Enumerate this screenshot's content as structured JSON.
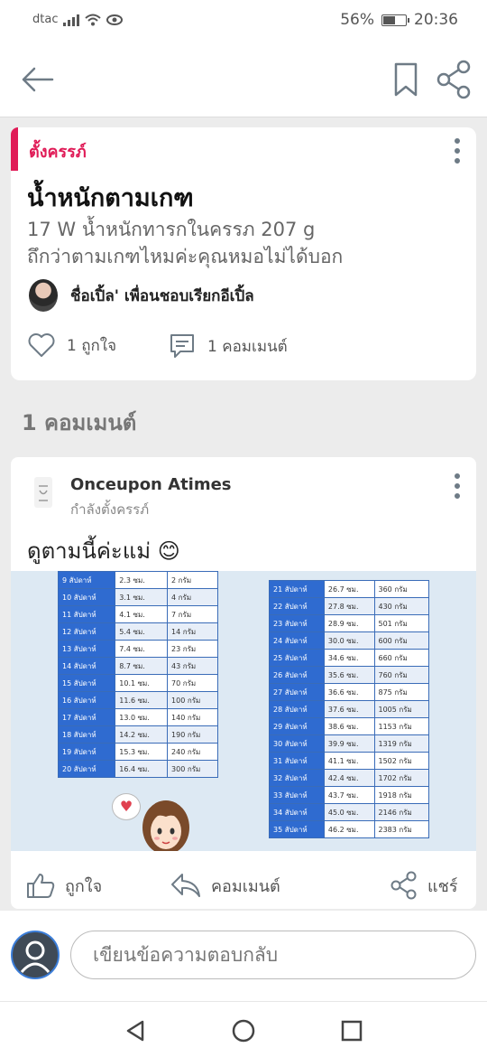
{
  "status_bar": {
    "carrier": "dtac",
    "battery_text": "56%",
    "battery_level": 0.56,
    "time": "20:36"
  },
  "post": {
    "tag": "ตั้งครรภ์",
    "title": "น้ำหนักตามเกฑ",
    "body": "17 W น้ำหนักทารกในครรภ 207 g\nถึกว่าตามเกฑไหมค่ะคุณหมอไม่ได้บอก",
    "author": "ชื่อเปิ้ล' เพื่อนชอบเรียกอีเปิ้ล",
    "likes_label": "1 ถูกใจ",
    "comments_label": "1 คอมเมนต์"
  },
  "comments_heading": "1 คอมเมนต์",
  "comment": {
    "author": "Onceupon Atimes",
    "status": "กำลังตั้งครรภ์",
    "text": "ดูตามนี้ค่ะแม่ 😊",
    "image": {
      "left_table": [
        [
          "9 สัปดาห์",
          "2.3 ซม.",
          "2 กรัม"
        ],
        [
          "10 สัปดาห์",
          "3.1 ซม.",
          "4 กรัม"
        ],
        [
          "11 สัปดาห์",
          "4.1 ซม.",
          "7 กรัม"
        ],
        [
          "12 สัปดาห์",
          "5.4 ซม.",
          "14 กรัม"
        ],
        [
          "13 สัปดาห์",
          "7.4 ซม.",
          "23 กรัม"
        ],
        [
          "14 สัปดาห์",
          "8.7 ซม.",
          "43 กรัม"
        ],
        [
          "15 สัปดาห์",
          "10.1 ซม.",
          "70 กรัม"
        ],
        [
          "16 สัปดาห์",
          "11.6 ซม.",
          "100 กรัม"
        ],
        [
          "17 สัปดาห์",
          "13.0 ซม.",
          "140 กรัม"
        ],
        [
          "18 สัปดาห์",
          "14.2 ซม.",
          "190 กรัม"
        ],
        [
          "19 สัปดาห์",
          "15.3 ซม.",
          "240 กรัม"
        ],
        [
          "20 สัปดาห์",
          "16.4 ซม.",
          "300 กรัม"
        ]
      ],
      "right_table": [
        [
          "21 สัปดาห์",
          "26.7 ซม.",
          "360 กรัม"
        ],
        [
          "22 สัปดาห์",
          "27.8 ซม.",
          "430 กรัม"
        ],
        [
          "23 สัปดาห์",
          "28.9 ซม.",
          "501 กรัม"
        ],
        [
          "24 สัปดาห์",
          "30.0 ซม.",
          "600 กรัม"
        ],
        [
          "25 สัปดาห์",
          "34.6 ซม.",
          "660 กรัม"
        ],
        [
          "26 สัปดาห์",
          "35.6 ซม.",
          "760 กรัม"
        ],
        [
          "27 สัปดาห์",
          "36.6 ซม.",
          "875 กรัม"
        ],
        [
          "28 สัปดาห์",
          "37.6 ซม.",
          "1005 กรัม"
        ],
        [
          "29 สัปดาห์",
          "38.6 ซม.",
          "1153 กรัม"
        ],
        [
          "30 สัปดาห์",
          "39.9 ซม.",
          "1319 กรัม"
        ],
        [
          "31 สัปดาห์",
          "41.1 ซม.",
          "1502 กรัม"
        ],
        [
          "32 สัปดาห์",
          "42.4 ซม.",
          "1702 กรัม"
        ],
        [
          "33 สัปดาห์",
          "43.7 ซม.",
          "1918 กรัม"
        ],
        [
          "34 สัปดาห์",
          "45.0 ซม.",
          "2146 กรัม"
        ],
        [
          "35 สัปดาห์",
          "46.2 ซม.",
          "2383 กรัม"
        ]
      ]
    },
    "actions": {
      "like": "ถูกใจ",
      "comment": "คอมเมนต์",
      "share": "แชร์"
    }
  },
  "reply": {
    "placeholder": "เขียนข้อความตอบกลับ"
  },
  "colors": {
    "accent": "#e01b57",
    "table_blue": "#2f6bd0",
    "icon_gray": "#6e7b86"
  },
  "icons": [
    "back-arrow-icon",
    "bookmark-icon",
    "share-icon",
    "kebab-menu-icon",
    "heart-icon",
    "comment-icon",
    "thumbs-up-icon",
    "reply-icon",
    "user-icon",
    "nav-back-icon",
    "nav-home-icon",
    "nav-recents-icon"
  ]
}
